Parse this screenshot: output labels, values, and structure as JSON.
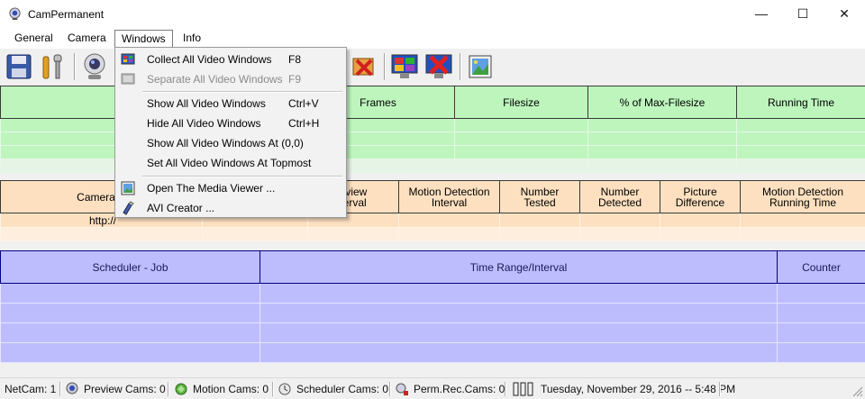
{
  "window": {
    "title": "CamPermanent",
    "minimize": "—",
    "maximize": "☐",
    "close": "✕"
  },
  "menubar": {
    "items": [
      "General",
      "Camera",
      "Windows",
      "Info"
    ]
  },
  "toolbar": {
    "buttons": [
      "save-icon",
      "tools-icon",
      "webcam-icon",
      "delete-window-icon",
      "monitor-icon",
      "close-monitor-icon",
      "media-viewer-icon"
    ]
  },
  "dropdown": {
    "items": [
      {
        "label": "Collect All Video Windows",
        "shortcut": "F8",
        "disabled": false
      },
      {
        "label": "Separate All Video Windows",
        "shortcut": "F9",
        "disabled": true
      },
      {
        "label": "Show All Video Windows",
        "shortcut": "Ctrl+V",
        "disabled": false
      },
      {
        "label": "Hide All Video Windows",
        "shortcut": "Ctrl+H",
        "disabled": false
      },
      {
        "label": "Show All Video Windows At (0,0)",
        "shortcut": "",
        "disabled": false
      },
      {
        "label": "Set All Video Windows At Topmost",
        "shortcut": "",
        "disabled": false
      },
      {
        "label": "Open The Media Viewer ...",
        "shortcut": "",
        "disabled": false
      },
      {
        "label": "AVI Creator ...",
        "shortcut": "",
        "disabled": false
      }
    ]
  },
  "recording_table": {
    "headers": [
      "",
      "",
      "Frames",
      "Filesize",
      "% of Max-Filesize",
      "Running Time"
    ]
  },
  "motion_table": {
    "headers": [
      "Camera N",
      "",
      "eview\nterval",
      "Motion Detection\nInterval",
      "Number\nTested",
      "Number\nDetected",
      "Picture\nDifference",
      "Motion Detection\nRunning Time"
    ],
    "row1_camera": "http://"
  },
  "scheduler_table": {
    "headers": [
      "Scheduler - Job",
      "Time Range/Interval",
      "Counter"
    ]
  },
  "statusbar": {
    "netcam": "NetCam: 1",
    "preview": "Preview Cams: 0",
    "motion": "Motion Cams: 0",
    "scheduler": "Scheduler Cams: 0",
    "permrec": "Perm.Rec.Cams: 0",
    "datetime": "Tuesday, November 29, 2016 -- 5:48 PM"
  }
}
